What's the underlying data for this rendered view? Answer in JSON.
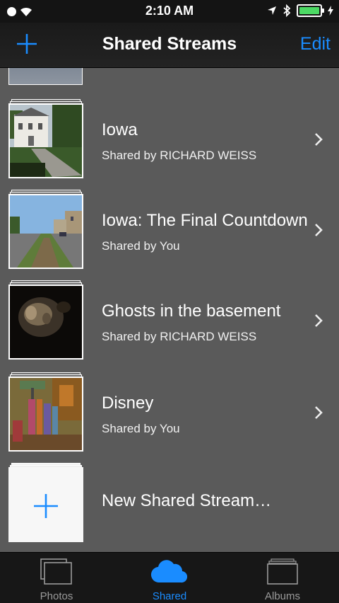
{
  "status_bar": {
    "time": "2:10 AM"
  },
  "nav": {
    "title": "Shared Streams",
    "edit_label": "Edit"
  },
  "streams": [
    {
      "title": "Iowa",
      "shared_by": "Shared by RICHARD WEISS"
    },
    {
      "title": "Iowa: The Final Countdown",
      "shared_by": "Shared by You"
    },
    {
      "title": "Ghosts in the basement",
      "shared_by": "Shared by RICHARD WEISS"
    },
    {
      "title": "Disney",
      "shared_by": "Shared by You"
    }
  ],
  "new_stream": {
    "label": "New Shared Stream…"
  },
  "tabs": [
    {
      "label": "Photos",
      "icon": "photos-icon",
      "active": false
    },
    {
      "label": "Shared",
      "icon": "cloud-icon",
      "active": true
    },
    {
      "label": "Albums",
      "icon": "albums-icon",
      "active": false
    }
  ],
  "colors": {
    "accent": "#1a8cff",
    "background": "#5a5a5a",
    "battery": "#4cd964"
  }
}
